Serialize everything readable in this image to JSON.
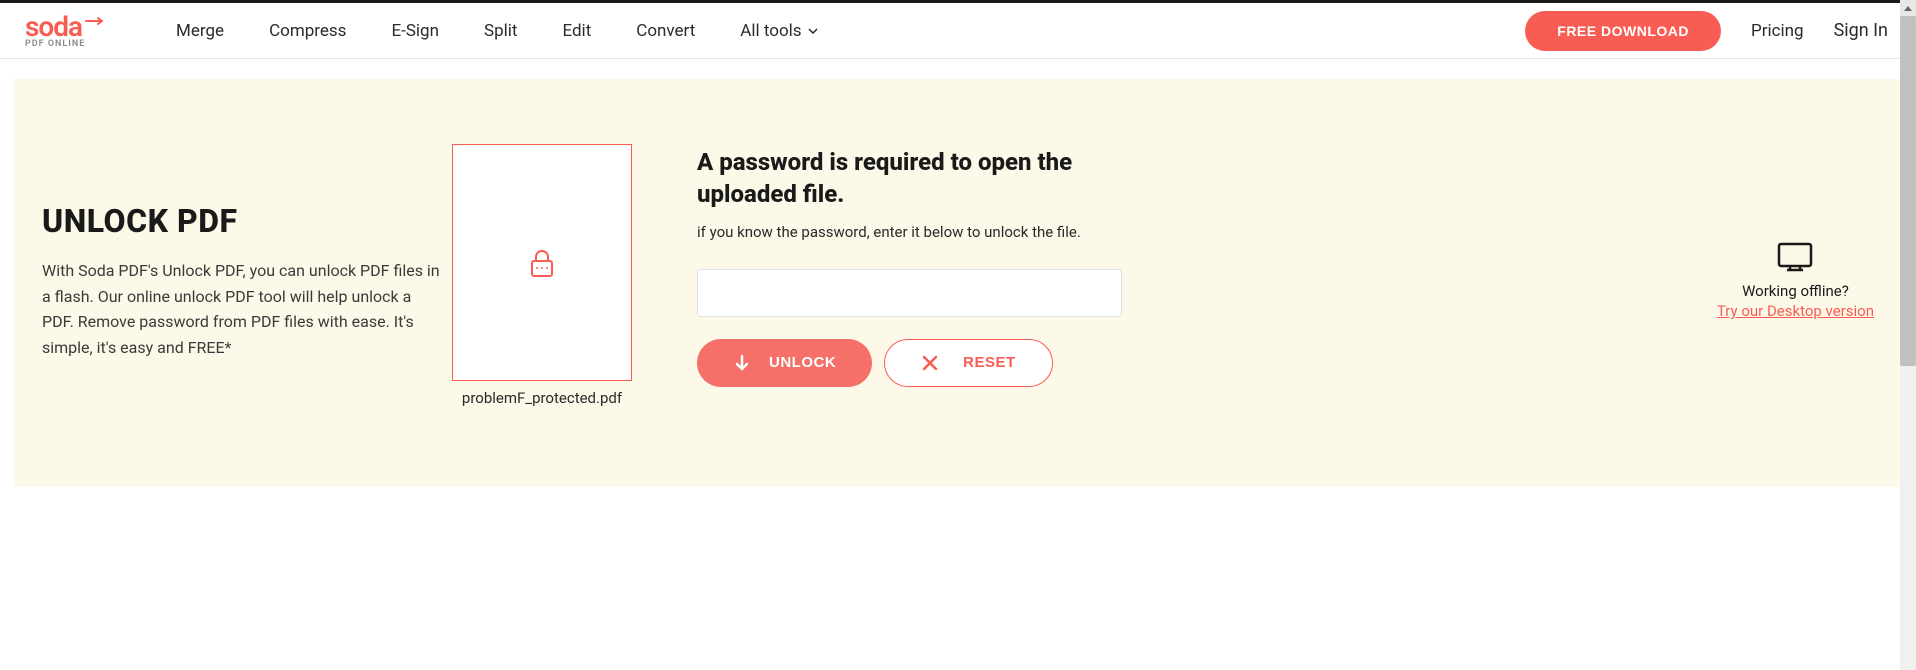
{
  "logo": {
    "main": "soda",
    "sub": "PDF ONLINE"
  },
  "nav": {
    "merge": "Merge",
    "compress": "Compress",
    "esign": "E-Sign",
    "split": "Split",
    "edit": "Edit",
    "convert": "Convert",
    "alltools": "All tools"
  },
  "header": {
    "download": "FREE DOWNLOAD",
    "pricing": "Pricing",
    "signin": "Sign In"
  },
  "main": {
    "title": "UNLOCK PDF",
    "description": "With Soda PDF's Unlock PDF, you can unlock PDF files in a flash. Our online unlock PDF tool will help unlock a PDF. Remove password from PDF files with ease. It's simple, it's easy and FREE*"
  },
  "file": {
    "name": "problemF_protected.pdf"
  },
  "password": {
    "heading": "A password is required to open the uploaded file.",
    "hint": "if you know the password, enter it below to unlock the file.",
    "value": "",
    "unlock_label": "UNLOCK",
    "reset_label": "RESET"
  },
  "offline": {
    "heading": "Working offline?",
    "link": "Try our Desktop version"
  }
}
